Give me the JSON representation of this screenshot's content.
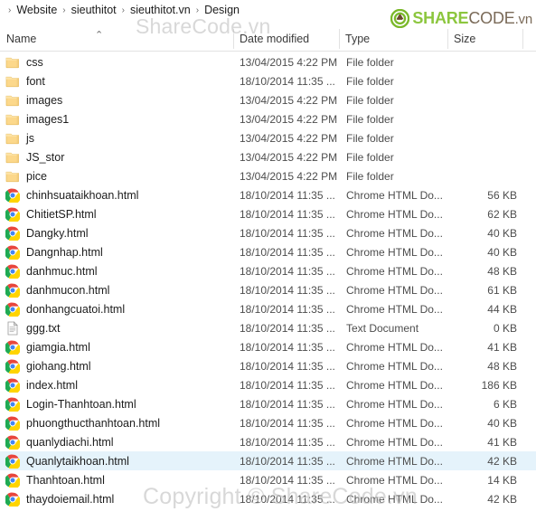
{
  "breadcrumb": {
    "separator": "›",
    "items": [
      "Website",
      "sieuthitot",
      "sieuthitot.vn",
      "Design"
    ]
  },
  "logo": {
    "share": "SHARE",
    "code": "CODE",
    "vn": ".vn",
    "share_color": "#8cc63e",
    "code_color": "#7a6a58",
    "mark_color": "#7ab829"
  },
  "watermarks": {
    "top": "ShareCode.vn",
    "bottom": "Copyright © ShareCode.vn"
  },
  "columns": {
    "name": "Name",
    "date_modified": "Date modified",
    "type": "Type",
    "size": "Size",
    "sort_indicator": "⌃"
  },
  "selection": {
    "row_index": 21,
    "highlight_color": "#e5f3fb"
  },
  "rows": [
    {
      "name": "css",
      "date": "13/04/2015 4:22 PM",
      "type": "File folder",
      "size": "",
      "icon": "folder-icon"
    },
    {
      "name": "font",
      "date": "18/10/2014 11:35 ...",
      "type": "File folder",
      "size": "",
      "icon": "folder-icon"
    },
    {
      "name": "images",
      "date": "13/04/2015 4:22 PM",
      "type": "File folder",
      "size": "",
      "icon": "folder-icon"
    },
    {
      "name": "images1",
      "date": "13/04/2015 4:22 PM",
      "type": "File folder",
      "size": "",
      "icon": "folder-icon"
    },
    {
      "name": "js",
      "date": "13/04/2015 4:22 PM",
      "type": "File folder",
      "size": "",
      "icon": "folder-icon"
    },
    {
      "name": "JS_stor",
      "date": "13/04/2015 4:22 PM",
      "type": "File folder",
      "size": "",
      "icon": "folder-icon"
    },
    {
      "name": "pice",
      "date": "13/04/2015 4:22 PM",
      "type": "File folder",
      "size": "",
      "icon": "folder-icon"
    },
    {
      "name": "chinhsuataikhoan.html",
      "date": "18/10/2014 11:35 ...",
      "type": "Chrome HTML Do...",
      "size": "56 KB",
      "icon": "chrome-icon"
    },
    {
      "name": "ChitietSP.html",
      "date": "18/10/2014 11:35 ...",
      "type": "Chrome HTML Do...",
      "size": "62 KB",
      "icon": "chrome-icon"
    },
    {
      "name": "Dangky.html",
      "date": "18/10/2014 11:35 ...",
      "type": "Chrome HTML Do...",
      "size": "40 KB",
      "icon": "chrome-icon"
    },
    {
      "name": "Dangnhap.html",
      "date": "18/10/2014 11:35 ...",
      "type": "Chrome HTML Do...",
      "size": "40 KB",
      "icon": "chrome-icon"
    },
    {
      "name": "danhmuc.html",
      "date": "18/10/2014 11:35 ...",
      "type": "Chrome HTML Do...",
      "size": "48 KB",
      "icon": "chrome-icon"
    },
    {
      "name": "danhmucon.html",
      "date": "18/10/2014 11:35 ...",
      "type": "Chrome HTML Do...",
      "size": "61 KB",
      "icon": "chrome-icon"
    },
    {
      "name": "donhangcuatoi.html",
      "date": "18/10/2014 11:35 ...",
      "type": "Chrome HTML Do...",
      "size": "44 KB",
      "icon": "chrome-icon"
    },
    {
      "name": "ggg.txt",
      "date": "18/10/2014 11:35 ...",
      "type": "Text Document",
      "size": "0 KB",
      "icon": "text-file-icon"
    },
    {
      "name": "giamgia.html",
      "date": "18/10/2014 11:35 ...",
      "type": "Chrome HTML Do...",
      "size": "41 KB",
      "icon": "chrome-icon"
    },
    {
      "name": "giohang.html",
      "date": "18/10/2014 11:35 ...",
      "type": "Chrome HTML Do...",
      "size": "48 KB",
      "icon": "chrome-icon"
    },
    {
      "name": "index.html",
      "date": "18/10/2014 11:35 ...",
      "type": "Chrome HTML Do...",
      "size": "186 KB",
      "icon": "chrome-icon"
    },
    {
      "name": "Login-Thanhtoan.html",
      "date": "18/10/2014 11:35 ...",
      "type": "Chrome HTML Do...",
      "size": "6 KB",
      "icon": "chrome-icon"
    },
    {
      "name": "phuongthucthanhtoan.html",
      "date": "18/10/2014 11:35 ...",
      "type": "Chrome HTML Do...",
      "size": "40 KB",
      "icon": "chrome-icon"
    },
    {
      "name": "quanlydiachi.html",
      "date": "18/10/2014 11:35 ...",
      "type": "Chrome HTML Do...",
      "size": "41 KB",
      "icon": "chrome-icon"
    },
    {
      "name": "Quanlytaikhoan.html",
      "date": "18/10/2014 11:35 ...",
      "type": "Chrome HTML Do...",
      "size": "42 KB",
      "icon": "chrome-icon"
    },
    {
      "name": "Thanhtoan.html",
      "date": "18/10/2014 11:35 ...",
      "type": "Chrome HTML Do...",
      "size": "14 KB",
      "icon": "chrome-icon"
    },
    {
      "name": "thaydoiemail.html",
      "date": "18/10/2014 11:35 ...",
      "type": "Chrome HTML Do...",
      "size": "42 KB",
      "icon": "chrome-icon"
    }
  ]
}
